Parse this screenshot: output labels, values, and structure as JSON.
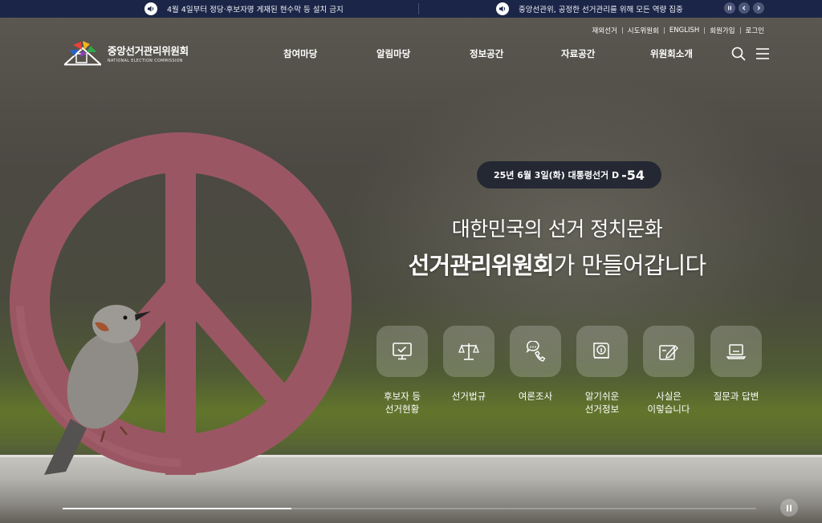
{
  "notices": [
    {
      "text": "4월 4일부터 정당·후보자명 게재된 현수막 등 설치 금지"
    },
    {
      "text": "중앙선관위, 공정한 선거관리를 위해 모든 역량 집중"
    }
  ],
  "notice_controls": {
    "pause_icon": "pause-icon",
    "prev_icon": "chevron-left-icon",
    "next_icon": "chevron-right-icon"
  },
  "util_links": [
    "재외선거",
    "시도위원회",
    "ENGLISH",
    "회원가입",
    "로그인"
  ],
  "logo": {
    "name_ko": "중앙선거관리위원회",
    "name_en": "NATIONAL ELECTION COMMISSION"
  },
  "nav": [
    "참여마당",
    "알림마당",
    "정보공간",
    "자료공간",
    "위원회소개"
  ],
  "header_icons": {
    "search": "search-icon",
    "menu": "hamburger-menu-icon"
  },
  "dday": {
    "label": "25년 6월 3일(화) 대통령선거 D",
    "value": "-54"
  },
  "headline": {
    "line1": "대한민국의 선거 정치문화",
    "line2_strong": "선거관리위원회",
    "line2_rest": "가 만들어갑니다"
  },
  "quick_links": [
    {
      "line1": "후보자 등",
      "line2": "선거현황",
      "icon": "monitor-check-icon"
    },
    {
      "line1": "선거법규",
      "line2": "",
      "icon": "scales-icon"
    },
    {
      "line1": "여론조사",
      "line2": "",
      "icon": "phone-chat-icon"
    },
    {
      "line1": "알기쉬운",
      "line2": "선거정보",
      "icon": "info-book-icon"
    },
    {
      "line1": "사실은",
      "line2": "이렇습니다",
      "icon": "document-pen-icon"
    },
    {
      "line1": "질문과 답변",
      "line2": "",
      "icon": "laptop-icon"
    }
  ],
  "slider": {
    "progress": 0.33,
    "pause_icon": "pause-icon"
  },
  "colors": {
    "notice_bg": "#1b2547",
    "peace_sign": "#9e5a66"
  }
}
